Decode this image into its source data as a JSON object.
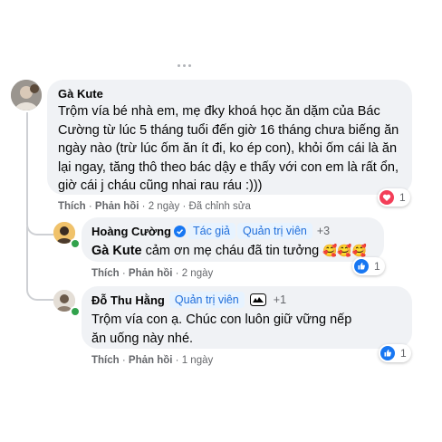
{
  "comments": [
    {
      "author": "Gà Kute",
      "text": "Trộm vía bé nhà em, mẹ đky khoá học ăn dặm của Bác Cường từ lúc 5 tháng tuổi đến giờ 16 tháng chưa biếng ăn ngày nào (trừ lúc ốm ăn ít đi, ko ép con), khỏi ốm cái là ăn lại ngay, tăng thô theo bác dậy e thấy với con em là rất ổn, giờ cái j cháu cũng nhai rau ráu :)))",
      "like_label": "Thích",
      "reply_label": "Phản hồi",
      "time": "2 ngày",
      "edited": "Đã chỉnh sửa",
      "reaction_count": "1",
      "reaction_icon": "heart-icon"
    },
    {
      "author": "Hoàng Cường",
      "badges": [
        "Tác giả",
        "Quản trị viên"
      ],
      "extra_badges": "+3",
      "mention": "Gà Kute",
      "text": " cảm ơn mẹ cháu đã tin tưởng ",
      "emojis": "🥰🥰🥰",
      "like_label": "Thích",
      "reply_label": "Phản hồi",
      "time": "2 ngày",
      "reaction_count": "1",
      "reaction_icon": "like-icon"
    },
    {
      "author": "Đỗ Thu Hằng",
      "badges": [
        "Quản trị viên"
      ],
      "extra_badges": "+1",
      "text": "Trộm vía con ạ. Chúc con luôn giữ vững nếp ăn uống này nhé.",
      "like_label": "Thích",
      "reply_label": "Phản hồi",
      "time": "1 ngày",
      "reaction_count": "1",
      "reaction_icon": "like-icon"
    }
  ],
  "colors": {
    "bubble": "#f0f2f5",
    "badge_bg": "#e7f3ff",
    "badge_text": "#216fdb",
    "like_blue": "#1877f2",
    "heart_red": "#f33e58",
    "online_green": "#31a24c"
  }
}
